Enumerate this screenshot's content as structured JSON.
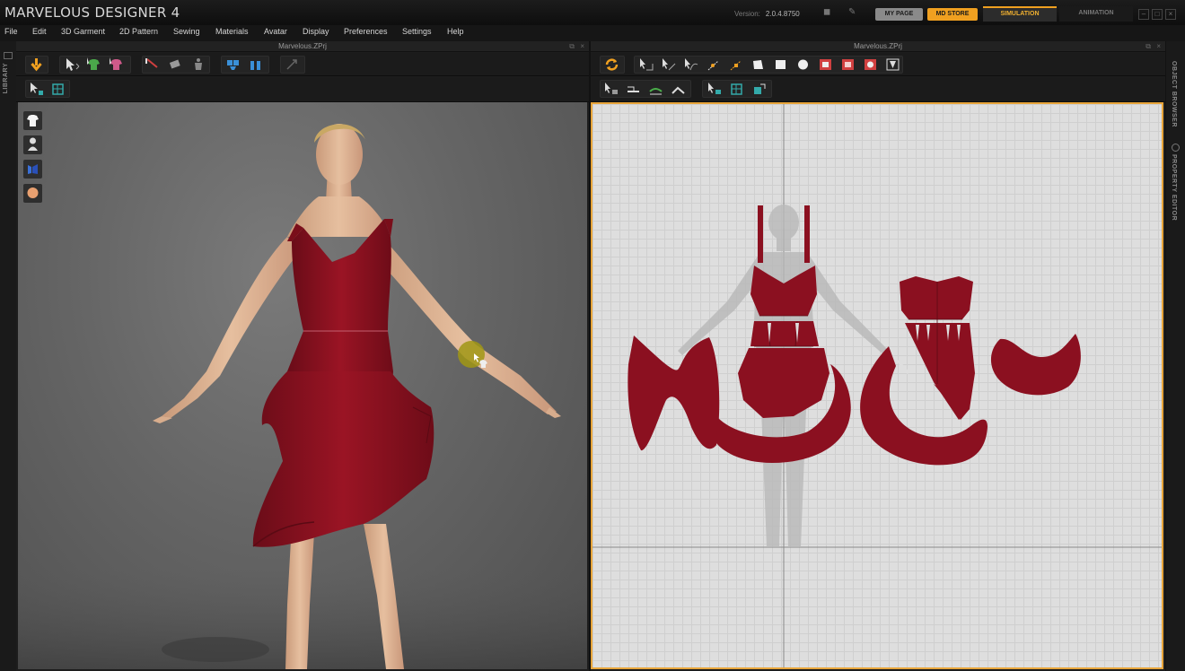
{
  "app": {
    "title": "MARVELOUS DESIGNER 4",
    "version_label": "Version:",
    "version_value": "2.0.4.8750",
    "my_page_label": "MY PAGE",
    "md_store_label": "MD STORE",
    "mode_simulation": "SIMULATION",
    "mode_animation": "ANIMATION"
  },
  "menu": {
    "items": [
      "File",
      "Edit",
      "3D Garment",
      "2D Pattern",
      "Sewing",
      "Materials",
      "Avatar",
      "Display",
      "Preferences",
      "Settings",
      "Help"
    ]
  },
  "sidebars": {
    "left_tab": "LIBRARY",
    "right_tab_1": "OBJECT BROWSER",
    "right_tab_2": "PROPERTY EDITOR"
  },
  "panel_3d": {
    "title": "Marvelous.ZPrj"
  },
  "panel_2d": {
    "title": "Marvelous.ZPrj"
  },
  "colors": {
    "accent": "#f0a020",
    "garment": "#8b1020",
    "viewport_border": "#e8a53a"
  }
}
